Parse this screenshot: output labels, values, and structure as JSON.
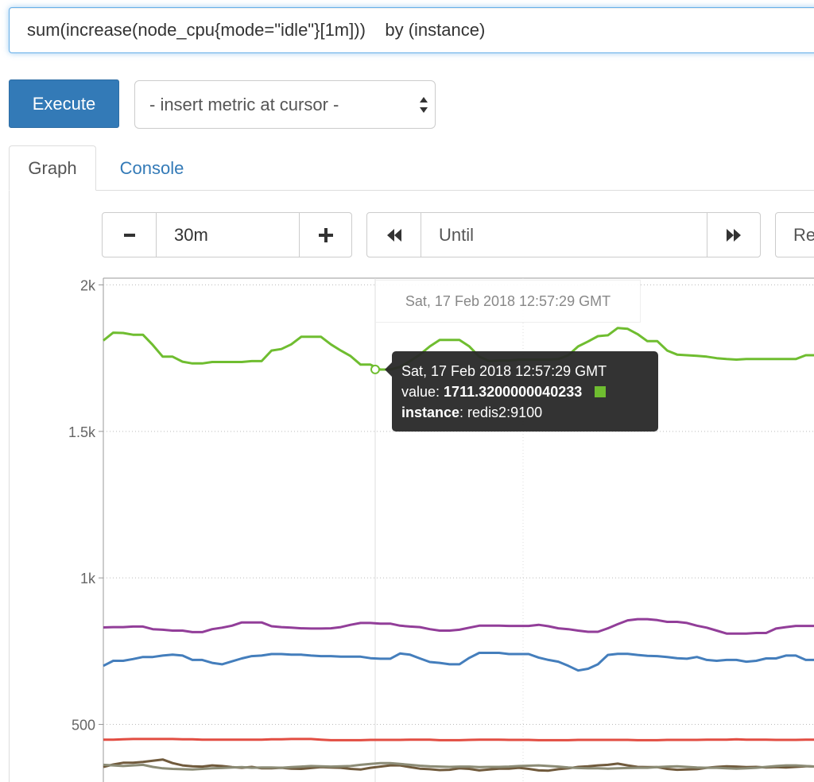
{
  "query": {
    "expression": "sum(increase(node_cpu{mode=\"idle\"}[1m]))    by (instance)"
  },
  "toolbar": {
    "execute_label": "Execute",
    "metric_select_value": "- insert metric at cursor -"
  },
  "tabs": [
    {
      "label": "Graph",
      "active": true
    },
    {
      "label": "Console",
      "active": false
    }
  ],
  "controls": {
    "range_minus": "−",
    "range_value": "30m",
    "range_plus": "+",
    "back_icon": "◀◀",
    "until_placeholder": "Until",
    "forward_icon": "▶▶",
    "res_partial": "Re"
  },
  "hover": {
    "time_label": "Sat, 17 Feb 2018 12:57:29 GMT"
  },
  "tooltip": {
    "time": "Sat, 17 Feb 2018 12:57:29 GMT",
    "value_key": "value",
    "value": "1711.3200000040233",
    "instance_key": "instance",
    "instance": "redis2:9100",
    "color": "#6fbd30"
  },
  "chart_data": {
    "type": "line",
    "ylabel_ticks": [
      "2k",
      "1.5k",
      "1k",
      "500"
    ],
    "y_ticks": [
      2000,
      1500,
      1000,
      500
    ],
    "ylim": [
      300,
      2020
    ],
    "x_range_minutes": 30,
    "grid": true,
    "series": [
      {
        "color": "#6fbd30",
        "values": [
          1810,
          1837,
          1836,
          1830,
          1830,
          1795,
          1755,
          1755,
          1738,
          1732,
          1732,
          1737,
          1737,
          1737,
          1737,
          1740,
          1740,
          1776,
          1781,
          1797,
          1823,
          1823,
          1823,
          1797,
          1776,
          1757,
          1728,
          1728,
          1711,
          1711,
          1720,
          1740,
          1762,
          1790,
          1812,
          1812,
          1812,
          1790,
          1755,
          1740,
          1742,
          1742,
          1745,
          1745,
          1745,
          1745,
          1747,
          1760,
          1790,
          1807,
          1825,
          1828,
          1853,
          1850,
          1832,
          1808,
          1808,
          1776,
          1762,
          1760,
          1758,
          1755,
          1750,
          1747,
          1745,
          1747,
          1747,
          1747,
          1747,
          1747,
          1747,
          1760,
          1760
        ]
      },
      {
        "color": "#923e99",
        "values": [
          831,
          832,
          832,
          834,
          834,
          825,
          823,
          820,
          820,
          815,
          815,
          825,
          830,
          837,
          848,
          848,
          848,
          835,
          832,
          830,
          828,
          827,
          827,
          828,
          832,
          840,
          846,
          846,
          844,
          844,
          837,
          834,
          832,
          825,
          820,
          820,
          823,
          830,
          837,
          837,
          837,
          836,
          836,
          836,
          840,
          835,
          828,
          825,
          820,
          816,
          816,
          828,
          842,
          855,
          859,
          859,
          856,
          850,
          850,
          846,
          837,
          830,
          820,
          810,
          810,
          810,
          812,
          812,
          827,
          832,
          836,
          836,
          836
        ]
      },
      {
        "color": "#447ebc",
        "values": [
          700,
          717,
          717,
          723,
          730,
          730,
          735,
          738,
          735,
          720,
          720,
          710,
          705,
          715,
          725,
          733,
          735,
          740,
          740,
          738,
          738,
          735,
          733,
          733,
          731,
          731,
          731,
          726,
          724,
          724,
          742,
          738,
          725,
          713,
          710,
          705,
          705,
          727,
          744,
          744,
          744,
          740,
          740,
          740,
          728,
          720,
          714,
          700,
          684,
          690,
          705,
          737,
          741,
          741,
          737,
          734,
          733,
          730,
          726,
          724,
          730,
          720,
          717,
          720,
          720,
          714,
          717,
          725,
          725,
          735,
          735,
          720,
          720
        ]
      },
      {
        "color": "#e24d42",
        "values": [
          448,
          448,
          449,
          450,
          450,
          450,
          450,
          450,
          449,
          449,
          448,
          448,
          448,
          448,
          448,
          448,
          448,
          449,
          449,
          450,
          450,
          450,
          448,
          446,
          446,
          446,
          446,
          447,
          447,
          447,
          447,
          448,
          448,
          448,
          446,
          446,
          446,
          447,
          448,
          448,
          448,
          447,
          447,
          447,
          446,
          446,
          446,
          446,
          447,
          447,
          447,
          447,
          447,
          447,
          446,
          446,
          446,
          447,
          447,
          447,
          447,
          448,
          448,
          448,
          449,
          448,
          448,
          448,
          447,
          447,
          447,
          448,
          448
        ]
      },
      {
        "color": "#705a3c",
        "values": [
          355,
          363,
          369,
          369,
          372,
          376,
          380,
          368,
          360,
          357,
          356,
          360,
          358,
          354,
          352,
          355,
          350,
          350,
          352,
          349,
          348,
          351,
          354,
          353,
          352,
          348,
          346,
          352,
          356,
          360,
          360,
          354,
          349,
          347,
          344,
          345,
          350,
          348,
          343,
          346,
          349,
          349,
          352,
          348,
          343,
          342,
          347,
          350,
          355,
          357,
          360,
          362,
          366,
          360,
          355,
          354,
          354,
          348,
          345,
          346,
          347,
          352,
          355,
          357,
          356,
          354,
          355,
          353,
          354,
          353,
          355,
          357,
          356
        ]
      },
      {
        "color": "#8c8c76",
        "values": [
          362,
          360,
          358,
          360,
          362,
          355,
          350,
          348,
          347,
          346,
          348,
          350,
          351,
          353,
          354,
          352,
          353,
          353,
          352,
          354,
          356,
          358,
          357,
          356,
          357,
          358,
          362,
          365,
          368,
          368,
          365,
          362,
          359,
          357,
          356,
          355,
          356,
          356,
          354,
          355,
          355,
          356,
          358,
          359,
          360,
          358,
          356,
          353,
          351,
          350,
          350,
          349,
          350,
          351,
          352,
          352,
          354,
          356,
          357,
          355,
          353,
          352,
          352,
          350,
          349,
          350,
          352,
          355,
          358,
          360,
          360,
          358,
          356
        ]
      }
    ]
  }
}
